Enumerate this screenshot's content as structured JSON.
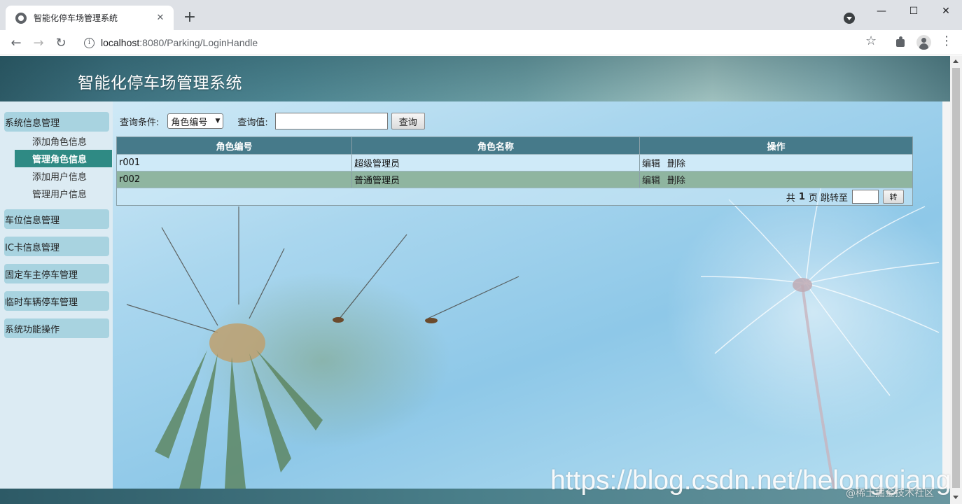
{
  "browser": {
    "tab_title": "智能化停车场管理系统",
    "tab_close": "✕",
    "new_tab": "+",
    "win_minimize": "—",
    "win_maximize": "☐",
    "win_close": "✕",
    "url_host": "localhost",
    "url_path": ":8080/Parking/LoginHandle",
    "back": "←",
    "forward": "→",
    "reload": "↻",
    "star": "☆",
    "menu": "⋮",
    "info": "i"
  },
  "page": {
    "title": "智能化停车场管理系统"
  },
  "sidebar": {
    "groups": [
      {
        "label": "系统信息管理"
      },
      {
        "label": "车位信息管理"
      },
      {
        "label": "IC卡信息管理"
      },
      {
        "label": "固定车主停车管理"
      },
      {
        "label": "临时车辆停车管理"
      },
      {
        "label": "系统功能操作"
      }
    ],
    "sub_items": [
      {
        "label": "添加角色信息"
      },
      {
        "label": "管理角色信息",
        "active": true
      },
      {
        "label": "添加用户信息"
      },
      {
        "label": "管理用户信息"
      }
    ]
  },
  "query": {
    "condition_label": "查询条件:",
    "condition_value": "角色编号",
    "value_label": "查询值:",
    "input_value": "",
    "button": "查询"
  },
  "table": {
    "headers": [
      "角色编号",
      "角色名称",
      "操作"
    ],
    "rows": [
      {
        "id": "r001",
        "name": "超级管理员",
        "edit": "编辑",
        "delete": "删除"
      },
      {
        "id": "r002",
        "name": "普通管理员",
        "edit": "编辑",
        "delete": "删除"
      }
    ]
  },
  "pager": {
    "prefix": "共",
    "total": "1",
    "suffix": "页 跳转至",
    "button": "转"
  },
  "watermark": {
    "url": "https://blog.csdn.net/helonggiang",
    "caption": "@稀土掘金技术社区"
  }
}
